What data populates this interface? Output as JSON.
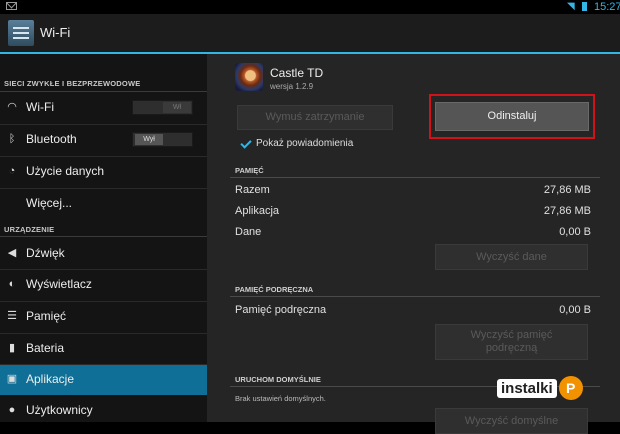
{
  "status_bar": {
    "time": "15:27"
  },
  "action_bar": {
    "title": "Wi-Fi"
  },
  "sidebar": {
    "section1_header": "SIECI ZWYKŁE I BEZPRZEWODOWE",
    "section2_header": "URZĄDZENIE",
    "wifi": {
      "label": "Wi-Fi",
      "toggle": "Wł"
    },
    "bluetooth": {
      "label": "Bluetooth",
      "toggle": "Wył"
    },
    "data_usage": "Użycie danych",
    "more": "Więcej...",
    "sound": "Dźwięk",
    "display": "Wyświetlacz",
    "storage": "Pamięć",
    "battery": "Bateria",
    "apps": "Aplikacje",
    "users": "Użytkownicy"
  },
  "app": {
    "name": "Castle TD",
    "version": "wersja 1.2.9",
    "force_stop": "Wymuś zatrzymanie",
    "uninstall": "Odinstaluj",
    "show_notifications": "Pokaż powiadomienia"
  },
  "storage": {
    "header": "PAMIĘĆ",
    "total_label": "Razem",
    "total_value": "27,86 MB",
    "app_label": "Aplikacja",
    "app_value": "27,86 MB",
    "data_label": "Dane",
    "data_value": "0,00 B",
    "clear_data": "Wyczyść dane"
  },
  "cache": {
    "header": "PAMIĘĆ PODRĘCZNA",
    "label": "Pamięć podręczna",
    "value": "0,00 B",
    "clear_cache_line1": "Wyczyść pamięć",
    "clear_cache_line2": "podręczną"
  },
  "launch_default": {
    "header": "URUCHOM DOMYŚLNIE",
    "note": "Brak ustawień domyślnych.",
    "clear_defaults": "Wyczyść domyślne"
  },
  "watermark": {
    "text": "instalki",
    "mark": "P"
  },
  "colors": {
    "accent": "#33b5e5",
    "selected": "#0f6f96",
    "highlight": "#d0121b",
    "brand": "#f39200"
  }
}
